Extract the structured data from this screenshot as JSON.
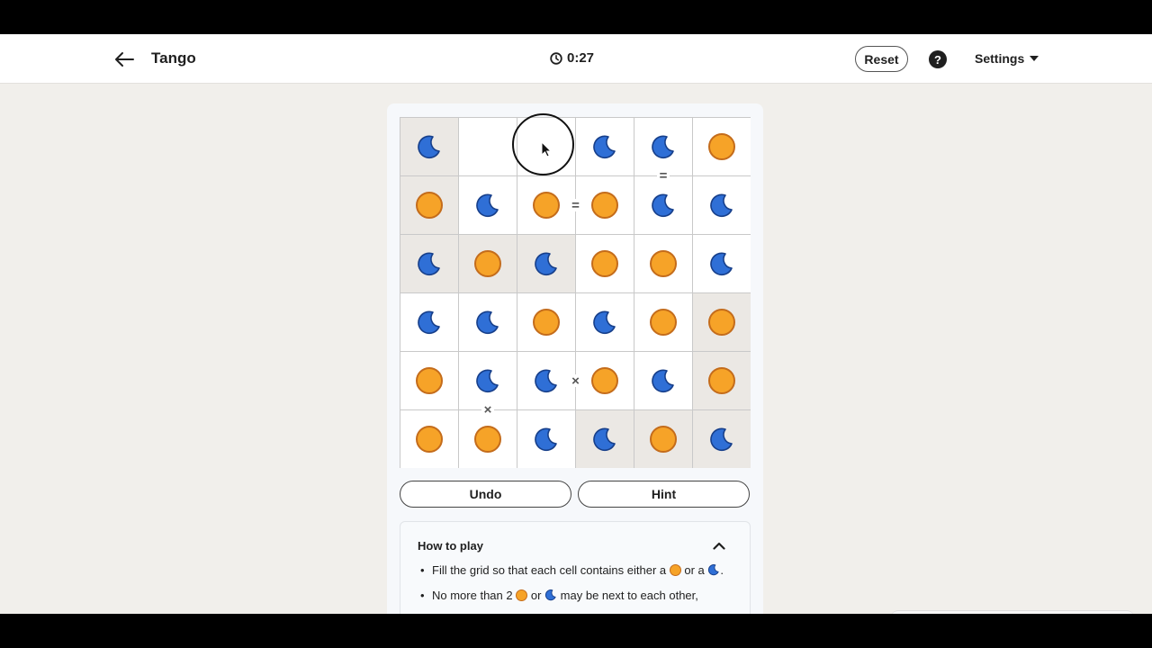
{
  "header": {
    "title": "Tango",
    "timer": "0:27",
    "reset_label": "Reset",
    "help_label": "?",
    "settings_label": "Settings"
  },
  "board": {
    "rows": [
      [
        "moon",
        "",
        "",
        "moon",
        "moon",
        "sun"
      ],
      [
        "sun",
        "moon",
        "sun",
        "sun",
        "moon",
        "moon"
      ],
      [
        "moon",
        "sun",
        "moon",
        "sun",
        "sun",
        "moon"
      ],
      [
        "moon",
        "moon",
        "sun",
        "moon",
        "sun",
        "sun"
      ],
      [
        "sun",
        "moon",
        "moon",
        "sun",
        "moon",
        "sun"
      ],
      [
        "sun",
        "sun",
        "moon",
        "moon",
        "sun",
        "moon"
      ]
    ],
    "locked": [
      [
        true,
        false,
        false,
        false,
        false,
        false
      ],
      [
        true,
        false,
        false,
        false,
        false,
        false
      ],
      [
        true,
        true,
        true,
        false,
        false,
        false
      ],
      [
        false,
        false,
        false,
        false,
        false,
        true
      ],
      [
        false,
        false,
        false,
        false,
        false,
        true
      ],
      [
        false,
        false,
        false,
        true,
        true,
        true
      ]
    ],
    "constraints": [
      {
        "symbol": "=",
        "between": "row0-col4/row1-col4"
      },
      {
        "symbol": "=",
        "between": "row1-col2/row1-col3"
      },
      {
        "symbol": "×",
        "between": "row4-col2/row4-col3"
      },
      {
        "symbol": "×",
        "between": "row4-col1/row5-col1"
      }
    ]
  },
  "actions": {
    "undo_label": "Undo",
    "hint_label": "Hint"
  },
  "howto": {
    "title": "How to play",
    "rule1_a": "Fill the grid so that each cell contains either a",
    "rule1_b": "or a",
    "rule1_c": ".",
    "rule2_a": "No more than 2",
    "rule2_b": "or",
    "rule2_c": "may be next to each other,"
  },
  "colors": {
    "sun": "#f6a328",
    "moon": "#2f6fd6",
    "locked_cell": "#ebe8e4"
  }
}
